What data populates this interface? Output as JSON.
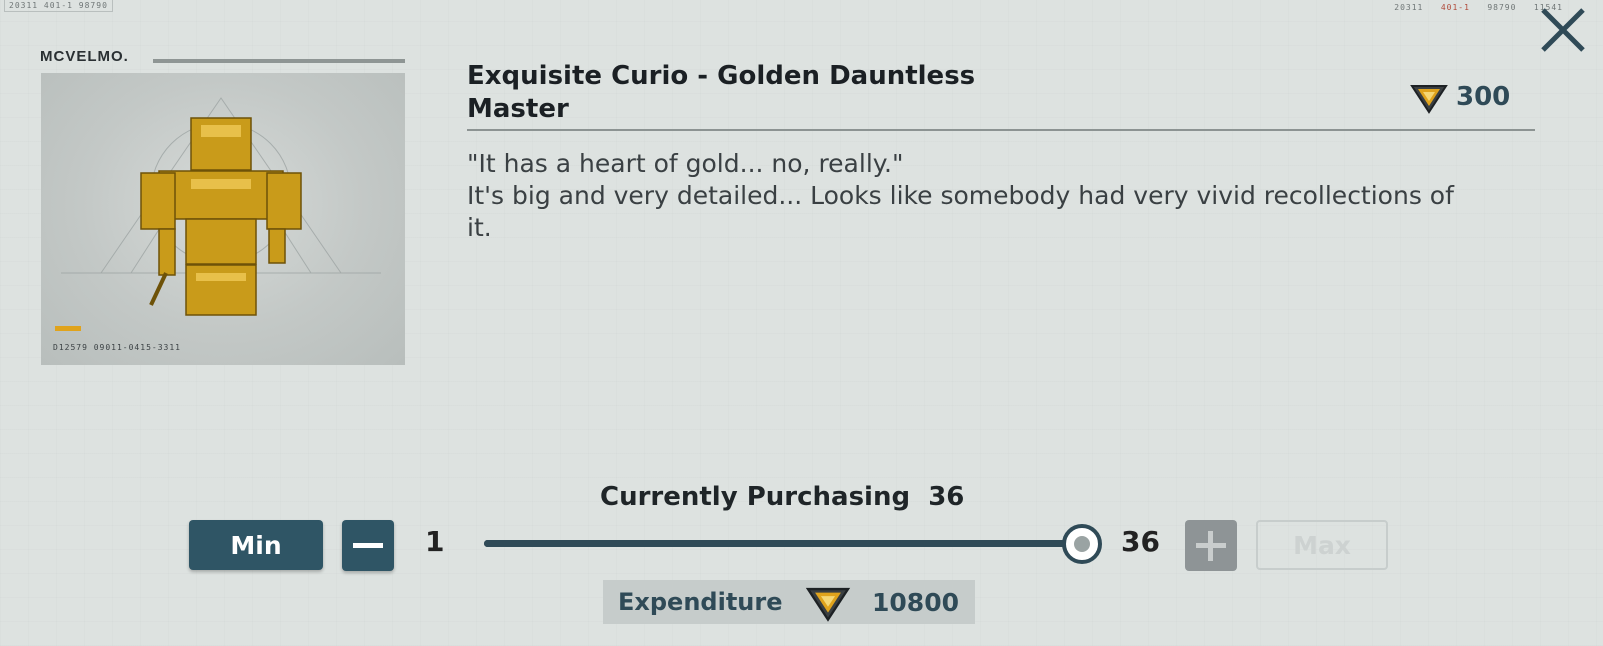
{
  "hud": {
    "top_left_codes": "20311   401-1   98790",
    "top_right_a": "20311",
    "top_right_b": "401-1",
    "top_right_c": "98790",
    "top_right_d": "11541"
  },
  "item": {
    "brand": "MCVELMO.",
    "title": "Exquisite Curio - Golden Dauntless Master",
    "price": "300",
    "description_line1": "\"It has a heart of gold... no, really.\"",
    "description_line2": "It's big and very detailed... Looks like somebody had very vivid recollections of it.",
    "card_code": "D12579  09011-0415-3311",
    "image_icon": "golden-robot-figure"
  },
  "purchase": {
    "label": "Currently Purchasing",
    "current_quantity": "36",
    "min_label": "Min",
    "max_label": "Max",
    "range_min": "1",
    "range_max": "36",
    "slider_fraction": 1.0,
    "expenditure_label": "Expenditure",
    "expenditure_value": "10800"
  },
  "colors": {
    "accent": "#2f5565",
    "accent_text": "#2f4a57",
    "background": "#dde2e0",
    "currency_gold": "#e0a31c"
  },
  "icons": {
    "close": "close-x-icon",
    "currency": "currency-token-icon"
  }
}
